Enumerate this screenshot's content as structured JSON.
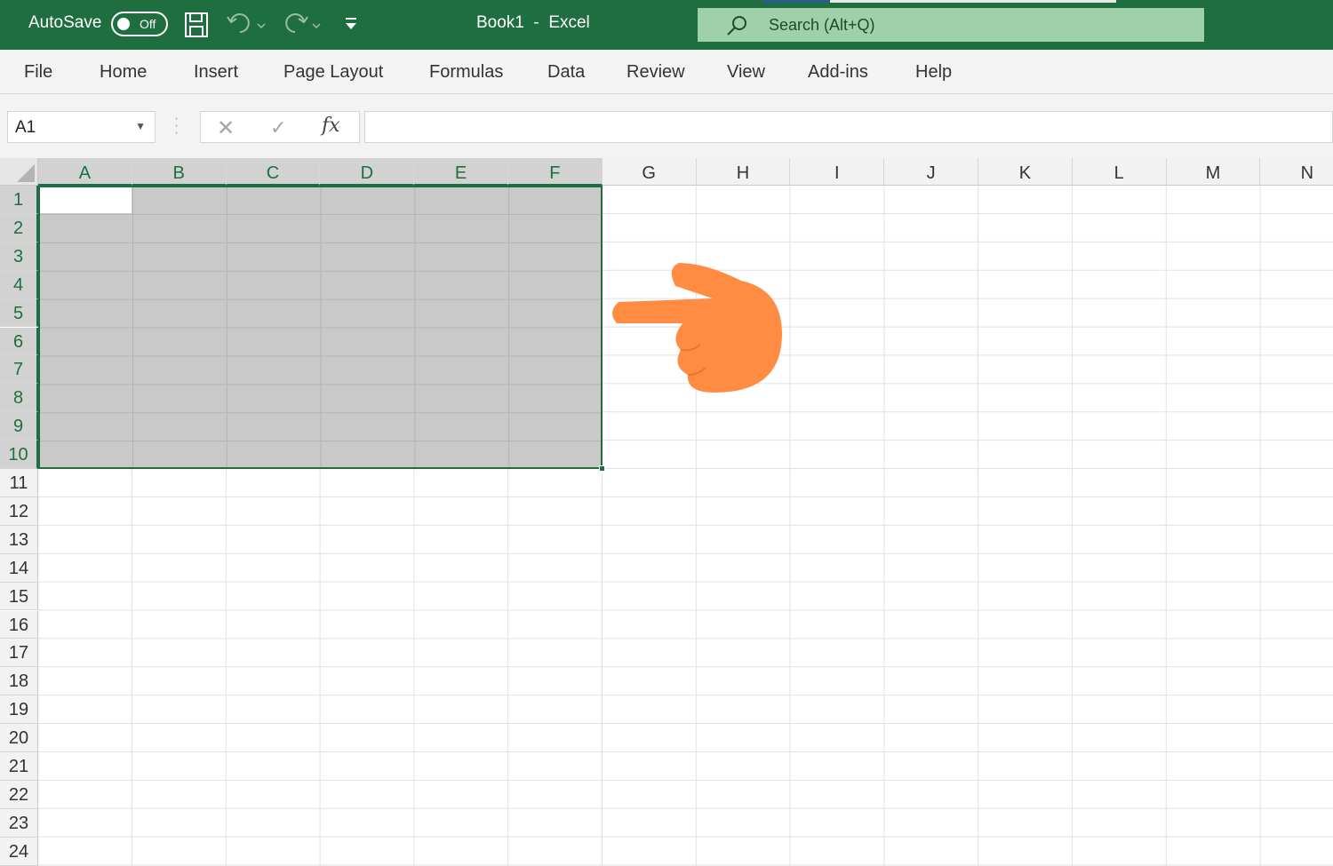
{
  "titlebar": {
    "autosave_label": "AutoSave",
    "autosave_state": "Off",
    "document_title": "Book1  -  Excel",
    "search_placeholder": "Search (Alt+Q)",
    "quick_access_icons": [
      "save-icon",
      "undo-icon",
      "redo-icon",
      "customize-quick-access-icon"
    ]
  },
  "ribbon": {
    "tabs": [
      "File",
      "Home",
      "Insert",
      "Page Layout",
      "Formulas",
      "Data",
      "Review",
      "View",
      "Add-ins",
      "Help"
    ]
  },
  "formula_bar": {
    "name_box": "A1",
    "cancel_symbol": "✕",
    "enter_symbol": "✓",
    "fx_label": "fx",
    "formula_value": ""
  },
  "grid": {
    "columns": [
      "A",
      "B",
      "C",
      "D",
      "E",
      "F",
      "G",
      "H",
      "I",
      "J",
      "K",
      "L",
      "M",
      "N"
    ],
    "rows": [
      "1",
      "2",
      "3",
      "4",
      "5",
      "6",
      "7",
      "8",
      "9",
      "10",
      "11",
      "12",
      "13",
      "14",
      "15",
      "16",
      "17",
      "18",
      "19",
      "20",
      "21",
      "22",
      "23",
      "24"
    ],
    "selected_range": "A1:F10",
    "active_cell": "A1"
  },
  "overlay": {
    "pointer": "pointing-hand-icon",
    "pointer_color": "#ff8c42"
  },
  "colors": {
    "title_bar": "#1e6e3f",
    "selection_border": "#1f6e3f",
    "selection_fill": "#c9c9c9"
  }
}
